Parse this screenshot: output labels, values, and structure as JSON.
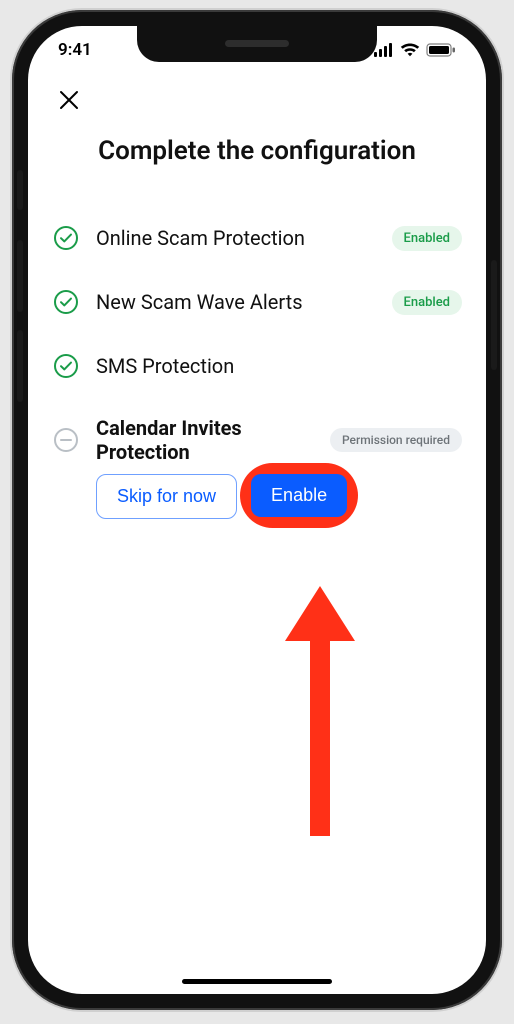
{
  "statusBar": {
    "time": "9:41"
  },
  "title": "Complete the configuration",
  "badges": {
    "enabled": "Enabled",
    "permissionRequired": "Permission required"
  },
  "items": [
    {
      "label": "Online Scam Protection",
      "status": "enabled"
    },
    {
      "label": "New Scam Wave Alerts",
      "status": "enabled"
    },
    {
      "label": "SMS Protection",
      "status": "none"
    },
    {
      "label": "Calendar Invites Protection",
      "status": "permission"
    }
  ],
  "buttons": {
    "skip": "Skip for now",
    "enable": "Enable"
  }
}
